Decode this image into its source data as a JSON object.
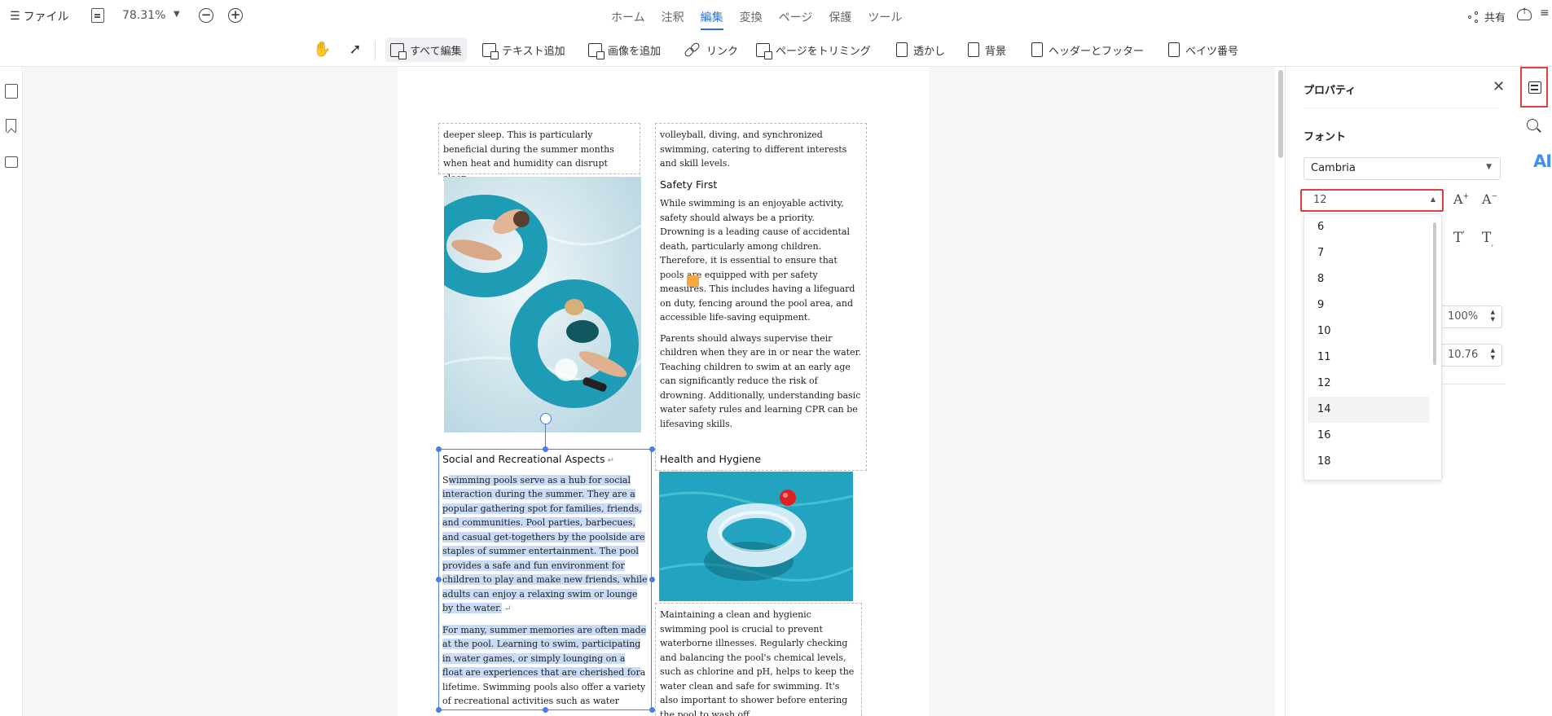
{
  "topbar": {
    "file_label": "ファイル",
    "zoom": "78.31%",
    "tabs": [
      {
        "label": "ホーム",
        "active": false
      },
      {
        "label": "注釈",
        "active": false
      },
      {
        "label": "編集",
        "active": true
      },
      {
        "label": "変換",
        "active": false
      },
      {
        "label": "ページ",
        "active": false
      },
      {
        "label": "保護",
        "active": false
      },
      {
        "label": "ツール",
        "active": false
      }
    ],
    "share_label": "共有"
  },
  "toolbar": {
    "edit_all": "すべて編集",
    "add_text": "テキスト追加",
    "add_image": "画像を追加",
    "link": "リンク",
    "crop_page": "ページをトリミング",
    "watermark": "透かし",
    "background": "背景",
    "header_footer": "ヘッダーとフッター",
    "bates": "ベイツ番号"
  },
  "document": {
    "col1_top": "deeper sleep. This is particularly beneficial during the summer months when heat and humidity can disrupt sleep.",
    "col1_heading": "Social and Recreational Aspects",
    "col1_para1_first": "S",
    "col1_para1_rest": "wimming pools serve as a hub for social interaction during the summer. They are a popular gathering spot for families, friends, and communities. Pool parties, barbecues, and casual get-togethers by the poolside are staples of summer entertainment. The pool provides a safe and fun environment for children to play and make new friends, while adults can enjoy a relaxing swim or lounge by the water.",
    "col1_para2_selected": "For many, summer memories are often made at the pool. Learning to swim, participating in water games, or simply lounging on a float are experiences that are cherished for",
    "col1_para2_rest": "a lifetime. Swimming pools also offer a variety of recreational activities such as water",
    "col2_top": "volleyball, diving, and synchronized swimming, catering to different interests and skill levels.",
    "col2_heading1": "Safety First",
    "col2_para1a": "While swimming is an enjoyable activity, safety should always be a priority. Drowning is a leading cause of accidental death, particularly among children. Therefore, it is essential to ensure that pools are equipped with p",
    "col2_para1b": "er safety measures. This includes having a lifeguard on duty, fencing around the pool area, and accessible life-saving equipment.",
    "col2_para2": "Parents should always supervise their children when they are in or near the water. Teaching children to swim at an early age can significantly reduce the risk of drowning. Additionally, understanding basic water safety rules and learning CPR can be lifesaving skills.",
    "col2_heading2": "Health and Hygiene",
    "col2_para3": "Maintaining a clean and hygienic swimming pool is crucial to prevent waterborne illnesses. Regularly checking and balancing the pool's chemical levels, such as chlorine and pH, helps to keep the water clean and safe for swimming. It's also important to shower before entering the pool to wash off"
  },
  "properties": {
    "title": "プロパティ",
    "font_section": "フォント",
    "font_family": "Cambria",
    "font_size": "12",
    "size_options": [
      "6",
      "7",
      "8",
      "9",
      "10",
      "11",
      "12",
      "14",
      "16",
      "18"
    ],
    "hovered_size": "14",
    "scale_value": "100%",
    "spacing_value": "10.76"
  },
  "right_rail": {
    "ai_label": "AI"
  },
  "colors": {
    "accent": "#2f6fe4",
    "highlight_box": "#e04040",
    "selection": "#c9dbf6"
  }
}
